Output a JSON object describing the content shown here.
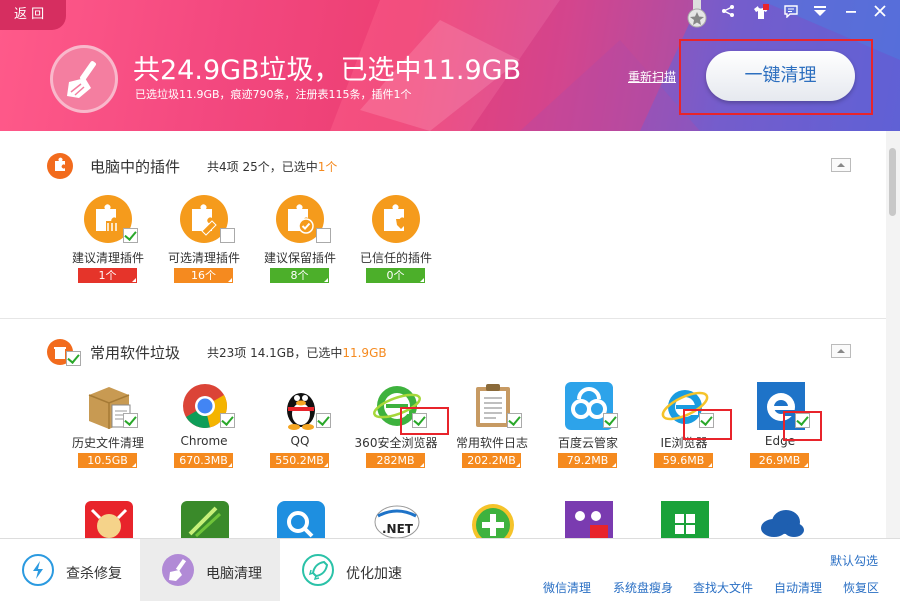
{
  "header": {
    "back": "返 回",
    "title": "共24.9GB垃圾，已选中11.9GB",
    "subtitle": "已选垃圾11.9GB，痕迹790条，注册表115条，插件1个",
    "rescan": "重新扫描",
    "onekey": "一键清理"
  },
  "plugins_section": {
    "title": "电脑中的插件",
    "stat_prefix": "共4项 25个，已选中",
    "stat_highlight": "1个",
    "items": [
      {
        "label": "建议清理插件",
        "badge": "1个",
        "checked": true
      },
      {
        "label": "可选清理插件",
        "badge": "16个",
        "checked": false
      },
      {
        "label": "建议保留插件",
        "badge": "8个",
        "checked": false
      },
      {
        "label": "已信任的插件",
        "badge": "0个",
        "checked": false
      }
    ]
  },
  "software_section": {
    "title": "常用软件垃圾",
    "stat_prefix": "共23项 14.1GB，已选中",
    "stat_highlight": "11.9GB",
    "items": [
      {
        "label": "历史文件清理",
        "badge": "10.5GB"
      },
      {
        "label": "Chrome",
        "badge": "670.3MB"
      },
      {
        "label": "QQ",
        "badge": "550.2MB"
      },
      {
        "label": "360安全浏览器",
        "badge": "282MB"
      },
      {
        "label": "常用软件日志",
        "badge": "202.2MB"
      },
      {
        "label": "百度云管家",
        "badge": "79.2MB"
      },
      {
        "label": "IE浏览器",
        "badge": "59.6MB"
      },
      {
        "label": "Edge",
        "badge": "26.9MB"
      }
    ]
  },
  "footer": {
    "tabs": [
      "查杀修复",
      "电脑清理",
      "优化加速"
    ],
    "default_check": "默认勾选",
    "links": [
      "微信清理",
      "系统盘瘦身",
      "查找大文件",
      "自动清理",
      "恢复区"
    ]
  },
  "colors": {
    "accent_orange": "#f58a1f",
    "badge_red": "#e5342a",
    "badge_green": "#4caf2a",
    "link_blue": "#2a6fc4",
    "highlight_box": "#e8242b"
  }
}
